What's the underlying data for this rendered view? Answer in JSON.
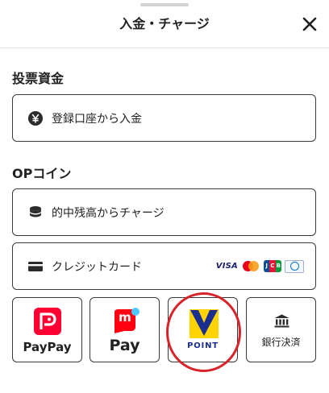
{
  "header": {
    "title": "入金・チャージ",
    "close_label": "close"
  },
  "sections": {
    "betting_funds": {
      "title": "投票資金",
      "deposit_button": {
        "label": "登録口座から入金",
        "icon": "yen-coin-icon"
      }
    },
    "op_coin": {
      "title": "OPコイン",
      "balance_charge_button": {
        "label": "的中残高からチャージ",
        "icon": "coin-stack-icon"
      },
      "credit_card_button": {
        "label": "クレジットカード",
        "icon": "credit-card-icon",
        "card_brands": [
          "VISA",
          "Mastercard",
          "JCB",
          "Diners Club"
        ]
      }
    }
  },
  "tiles": [
    {
      "id": "paypay",
      "label": "PayPay",
      "icon": "paypay-logo-icon",
      "accent": "#ff0033"
    },
    {
      "id": "merpay",
      "label": "Pay",
      "logo_letter": "m",
      "icon": "merpay-logo-icon",
      "accent": "#ff0211"
    },
    {
      "id": "vpoint",
      "label": "POINT",
      "icon": "v-point-logo-icon",
      "accent": "#1a2e8f"
    },
    {
      "id": "bank",
      "label": "銀行決済",
      "icon": "bank-icon"
    }
  ],
  "logos": {
    "visa_text": "VISA",
    "jcb_letters": [
      "J",
      "C",
      "B"
    ]
  },
  "colors": {
    "border": "#3a3a3a",
    "annotation": "#d8232a",
    "vpoint_yellow": "#ffd400"
  }
}
